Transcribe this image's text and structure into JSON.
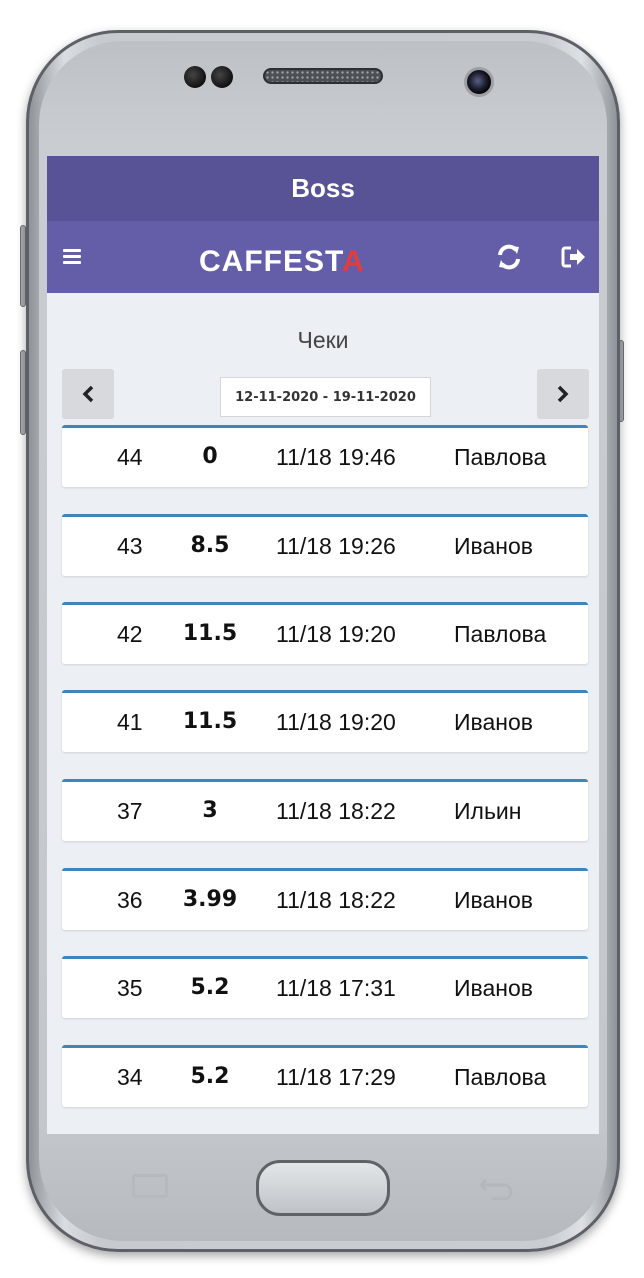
{
  "header": {
    "title": "Boss"
  },
  "navbar": {
    "logo_main": "CAFFEST",
    "logo_accent": "A",
    "icons": [
      "menu-icon",
      "refresh-icon",
      "logout-icon"
    ]
  },
  "page": {
    "heading": "Чеки",
    "date_range": "12-11-2020 - 19-11-2020",
    "prev": "‹",
    "next": "›"
  },
  "receipts": [
    {
      "num": "44",
      "sum": "0",
      "time": "11/18 19:46",
      "name": "Павлова"
    },
    {
      "num": "43",
      "sum": "8.5",
      "time": "11/18 19:26",
      "name": "Иванов"
    },
    {
      "num": "42",
      "sum": "11.5",
      "time": "11/18 19:20",
      "name": "Павлова"
    },
    {
      "num": "41",
      "sum": "11.5",
      "time": "11/18 19:20",
      "name": "Иванов"
    },
    {
      "num": "37",
      "sum": "3",
      "time": "11/18 18:22",
      "name": "Ильин"
    },
    {
      "num": "36",
      "sum": "3.99",
      "time": "11/18 18:22",
      "name": "Иванов"
    },
    {
      "num": "35",
      "sum": "5.2",
      "time": "11/18 17:31",
      "name": "Иванов"
    },
    {
      "num": "34",
      "sum": "5.2",
      "time": "11/18 17:29",
      "name": "Павлова"
    }
  ],
  "colors": {
    "title_bar": "#585396",
    "nav_bar": "#645ea8",
    "card_accent": "#3d86bd",
    "logo_accent": "#e23d3d"
  }
}
